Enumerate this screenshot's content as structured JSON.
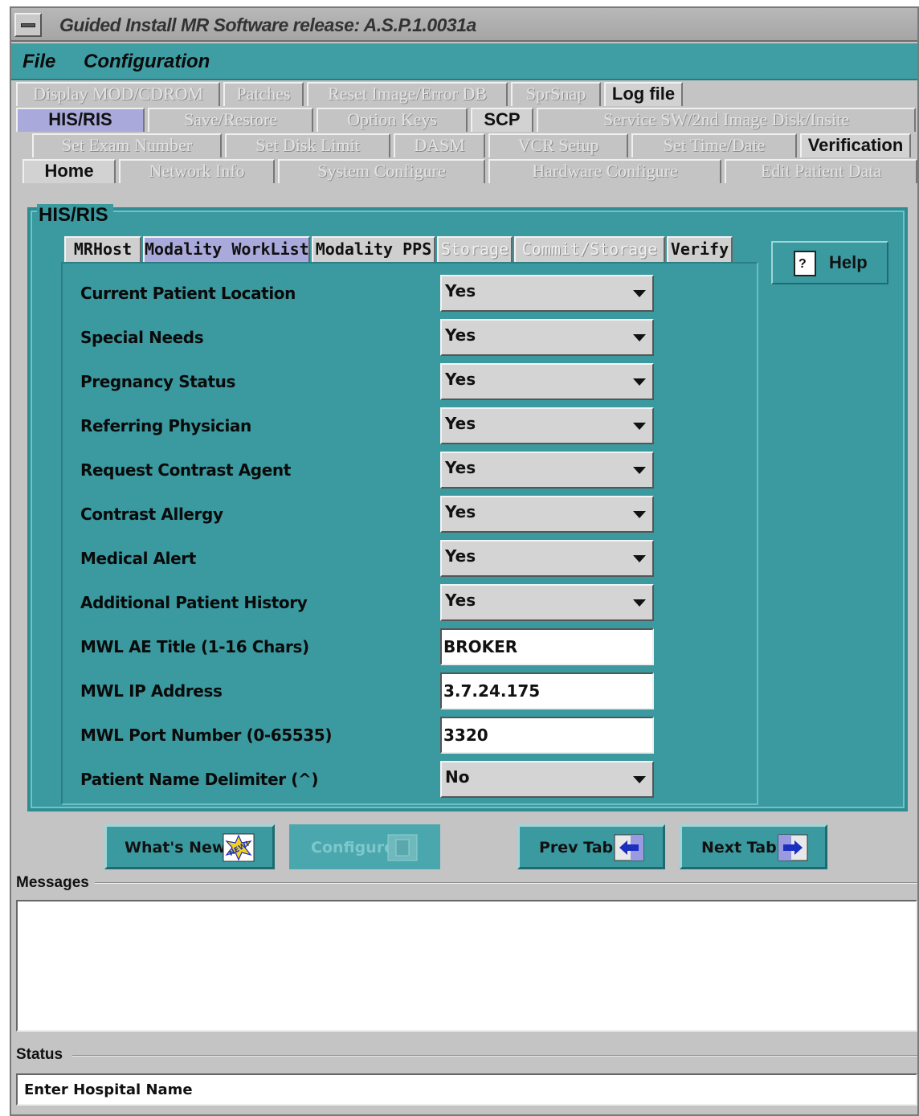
{
  "window": {
    "title": "Guided Install  MR Software release: A.S.P.1.0031a"
  },
  "menubar": {
    "file": "File",
    "configuration": "Configuration"
  },
  "tabs": {
    "row1": [
      "Display MOD/CDROM",
      "Patches",
      "Reset Image/Error DB",
      "SprSnap",
      "Log file"
    ],
    "row2": [
      "HIS/RIS",
      "Save/Restore",
      "Option Keys",
      "SCP",
      "Service SW/2nd Image Disk/Insite"
    ],
    "row3": [
      "Set Exam Number",
      "Set Disk Limit",
      "DASM",
      "VCR Setup",
      "Set Time/Date",
      "Verification"
    ],
    "row4": [
      "Home",
      "Network Info",
      "System Configure",
      "Hardware Configure",
      "Edit Patient Data"
    ],
    "selected": "HIS/RIS"
  },
  "panel": {
    "title": "HIS/RIS",
    "subtabs": [
      "MRHost",
      "Modality WorkList",
      "Modality PPS",
      "Storage",
      "Commit/Storage",
      "Verify"
    ],
    "selected_subtab": "Modality WorkList",
    "help_label": "Help"
  },
  "fields": [
    {
      "label": "Current Patient Location",
      "value": "Yes",
      "type": "select"
    },
    {
      "label": "Special Needs",
      "value": "Yes",
      "type": "select"
    },
    {
      "label": "Pregnancy Status",
      "value": "Yes",
      "type": "select"
    },
    {
      "label": "Referring Physician",
      "value": "Yes",
      "type": "select"
    },
    {
      "label": "Request Contrast Agent",
      "value": "Yes",
      "type": "select"
    },
    {
      "label": "Contrast Allergy",
      "value": "Yes",
      "type": "select"
    },
    {
      "label": "Medical Alert",
      "value": "Yes",
      "type": "select"
    },
    {
      "label": "Additional Patient History",
      "value": "Yes",
      "type": "select"
    },
    {
      "label": "MWL AE Title (1-16 Chars)",
      "value": "BROKER",
      "type": "text"
    },
    {
      "label": "MWL IP Address",
      "value": "3.7.24.175",
      "type": "text"
    },
    {
      "label": "MWL Port Number (0-65535)",
      "value": "3320",
      "type": "text"
    },
    {
      "label": "Patient Name Delimiter (^)",
      "value": "No",
      "type": "select"
    }
  ],
  "buttons": {
    "whats_new": "What's New",
    "configure": "Configure",
    "prev_tab": "Prev Tab",
    "next_tab": "Next Tab"
  },
  "messages": {
    "label": "Messages",
    "text": ""
  },
  "status": {
    "label": "Status",
    "text": "Enter Hospital Name"
  },
  "icons": {
    "help": "help-page-icon",
    "whats_new": "new-badge-icon",
    "configure": "configure-icon",
    "prev_tab": "left-arrow-icon",
    "next_tab": "right-arrow-icon"
  }
}
